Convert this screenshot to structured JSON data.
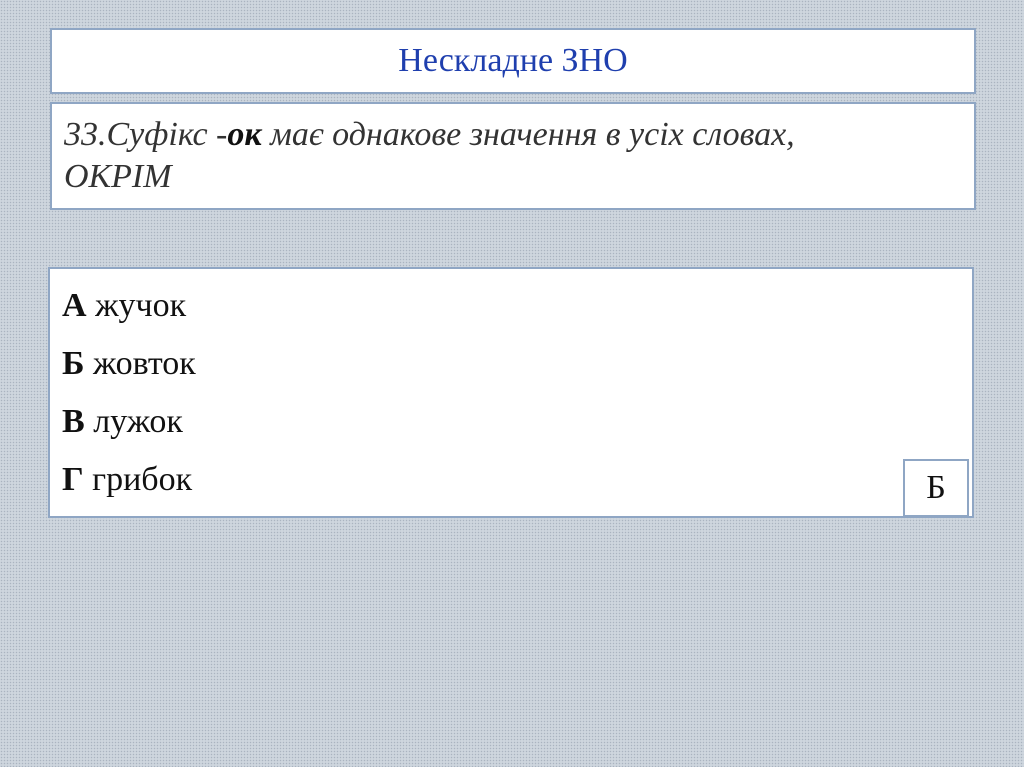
{
  "title": "Нескладне ЗНО",
  "question": {
    "prefix": "33.Суфікс -",
    "suffix": "ок",
    "rest_line1": " має однакове значення в усіх словах,",
    "rest_line2": "ОКРІМ"
  },
  "options": [
    {
      "letter": "А",
      "word": "жучок"
    },
    {
      "letter": "Б",
      "word": "жовток"
    },
    {
      "letter": "В",
      "word": "лужок"
    },
    {
      "letter": "Г",
      "word": "грибок"
    }
  ],
  "answer": "Б",
  "colors": {
    "title": "#1f3fae",
    "border": "#8fa6c4",
    "background": "#d4dbe3"
  }
}
